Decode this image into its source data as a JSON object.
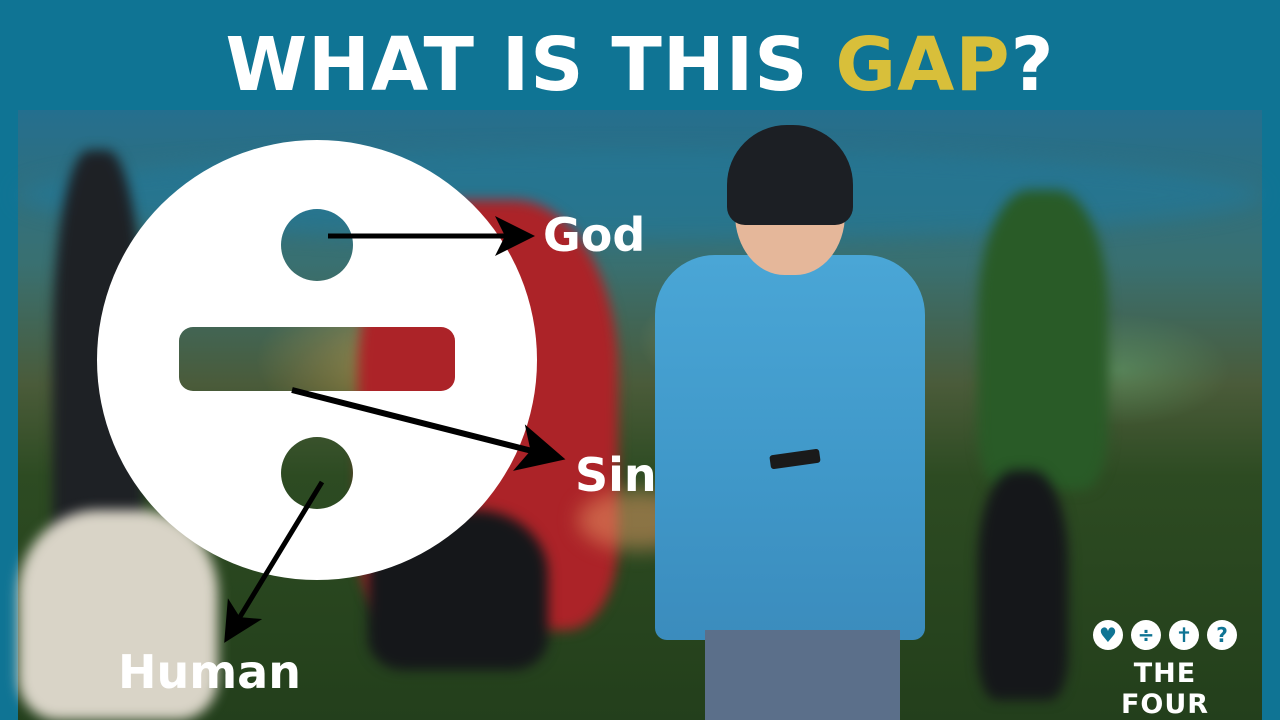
{
  "heading": {
    "text_before": "WHAT IS THIS ",
    "text_accent": "GAP",
    "text_after": "?"
  },
  "diagram": {
    "labels": {
      "god": "God",
      "sin": "Sin",
      "human": "Human"
    }
  },
  "logo": {
    "icons": [
      "heart-icon",
      "divide-icon",
      "cross-icon",
      "question-icon"
    ],
    "text": "THE FOUR"
  },
  "colors": {
    "background": "#0f7494",
    "accent": "#d8bf3a",
    "text": "#ffffff"
  }
}
